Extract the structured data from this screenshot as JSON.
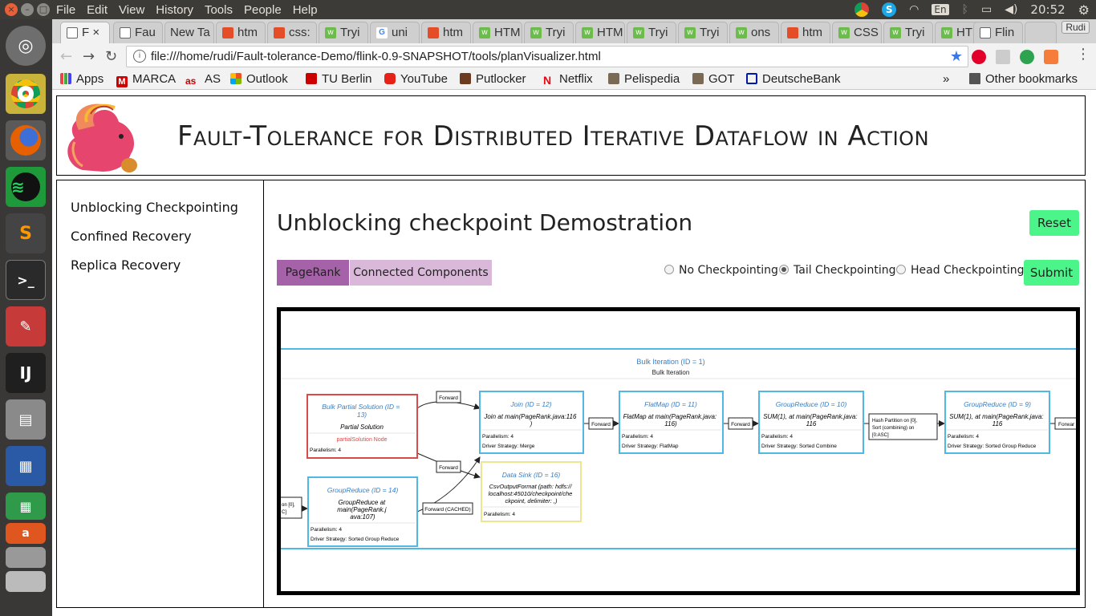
{
  "desktop": {
    "menus": [
      "File",
      "Edit",
      "View",
      "History",
      "Tools",
      "People",
      "Help"
    ],
    "keyboard_layout": "En",
    "clock": "20:52"
  },
  "browser": {
    "tabs": [
      {
        "label": "F",
        "icon": "page-icon"
      },
      {
        "label": "Fau",
        "icon": "page-icon"
      },
      {
        "label": "New Ta",
        "icon": "none"
      },
      {
        "label": "htm",
        "icon": "html5-icon"
      },
      {
        "label": "css:",
        "icon": "css-icon"
      },
      {
        "label": "Tryi",
        "icon": "w3schools-icon"
      },
      {
        "label": "uni",
        "icon": "google-icon"
      },
      {
        "label": "htm",
        "icon": "html5-icon"
      },
      {
        "label": "HTM",
        "icon": "w3schools-icon"
      },
      {
        "label": "Tryi",
        "icon": "w3schools-icon"
      },
      {
        "label": "HTM",
        "icon": "w3schools-icon"
      },
      {
        "label": "Tryi",
        "icon": "w3schools-icon"
      },
      {
        "label": "Tryi",
        "icon": "w3schools-icon"
      },
      {
        "label": "ons",
        "icon": "w3schools-icon"
      },
      {
        "label": "htm",
        "icon": "html5-icon"
      },
      {
        "label": "CSS",
        "icon": "w3schools-icon"
      },
      {
        "label": "Tryi",
        "icon": "w3schools-icon"
      },
      {
        "label": "HTM",
        "icon": "w3schools-icon"
      },
      {
        "label": "Flin",
        "icon": "page-icon"
      }
    ],
    "profile_name": "Rudi",
    "url": "file:///home/rudi/Fault-tolerance-Demo/flink-0.9-SNAPSHOT/tools/planVisualizer.html",
    "bookmarks": [
      {
        "label": "Apps",
        "icon": "apps-grid-icon"
      },
      {
        "label": "MARCA",
        "icon": "marca-icon"
      },
      {
        "label": "AS",
        "icon": "as-icon"
      },
      {
        "label": "Outlook",
        "icon": "windows-icon"
      },
      {
        "label": "TU Berlin",
        "icon": "tu-berlin-icon"
      },
      {
        "label": "YouTube",
        "icon": "youtube-icon"
      },
      {
        "label": "Putlocker",
        "icon": "putlocker-icon"
      },
      {
        "label": "Netflix",
        "icon": "netflix-icon"
      },
      {
        "label": "Pelispedia",
        "icon": "film-icon"
      },
      {
        "label": "GOT",
        "icon": "film-icon"
      },
      {
        "label": "DeutscheBank",
        "icon": "deutschebank-icon"
      }
    ],
    "overflow_label": "»",
    "other_bookmarks": "Other bookmarks"
  },
  "page": {
    "title": "Fault-Tolerance for Distributed Iterative Dataflow in Action",
    "nav": [
      "Unblocking Checkpointing",
      "Confined Recovery",
      "Replica Recovery"
    ],
    "heading": "Unblocking checkpoint Demostration",
    "reset_label": "Reset",
    "submit_label": "Submit",
    "algorithm_tabs": [
      {
        "label": "PageRank",
        "selected": true
      },
      {
        "label": "Connected Components",
        "selected": false
      }
    ],
    "checkpoint_options": [
      {
        "label": "No Checkpointing",
        "checked": false
      },
      {
        "label": "Tail Checkpointing",
        "checked": true
      },
      {
        "label": "Head Checkpointing",
        "checked": false
      }
    ],
    "colors": {
      "accent_green": "#4cf58a",
      "tab_selected": "#a562a8",
      "tab_unselected": "#d9b8d9",
      "node_blue": "#4fb8e3",
      "node_red": "#d94a4a",
      "node_yellow": "#ede690",
      "node_title_blue": "#3a7fc4"
    }
  },
  "plan": {
    "iteration_title": "Bulk Iteration (ID = 1)",
    "iteration_subtitle": "Bulk Iteration",
    "nodes": {
      "partial": {
        "title": "Bulk Partial Solution (ID = 13)",
        "desc": "Partial Solution",
        "extra": "partialSolution Node",
        "parallelism": "Parallelism: 4"
      },
      "join": {
        "title": "Join (ID = 12)",
        "desc": "Join at main(PageRank.java:116 )",
        "parallelism": "Parallelism: 4",
        "strategy": "Driver Strategy: Merge"
      },
      "flatmap": {
        "title": "FlatMap (ID = 11)",
        "desc": "FlatMap at main(PageRank.java: 116)",
        "parallelism": "Parallelism: 4",
        "strategy": "Driver Strategy: FlatMap"
      },
      "gr10": {
        "title": "GroupReduce (ID = 10)",
        "desc": "SUM(1), at main(PageRank.java: 116",
        "parallelism": "Parallelism: 4",
        "strategy": "Driver Strategy: Sorted Combine"
      },
      "gr9": {
        "title": "GroupReduce (ID = 9)",
        "desc": "SUM(1), at main(PageRank.java: 116",
        "parallelism": "Parallelism: 4",
        "strategy": "Driver Strategy: Sorted Group Reduce"
      },
      "gr14": {
        "title": "GroupReduce (ID = 14)",
        "desc": "GroupReduce at main(PageRank.j ava:107)",
        "parallelism": "Parallelism: 4",
        "strategy": "Driver Strategy: Sorted Group Reduce"
      },
      "sink": {
        "title": "Data Sink (ID = 16)",
        "desc": "CsvOutputFormat (path: hdfs:// localhost:45010/checkpoint/che ckpoint, delimiter: ,)",
        "parallelism": "Parallelism: 4"
      }
    },
    "edges": {
      "forward1": "Forward",
      "forward2": "Forward",
      "forward3": "Forward",
      "forward4": "Forward",
      "forward5": "Forward",
      "forward6": "Forwar",
      "hash": "Hash Partition on [0], Sort (combining) on [0:ASC]",
      "cached": "Forward (CACHED)",
      "left_partial": "on [0], C]"
    }
  }
}
